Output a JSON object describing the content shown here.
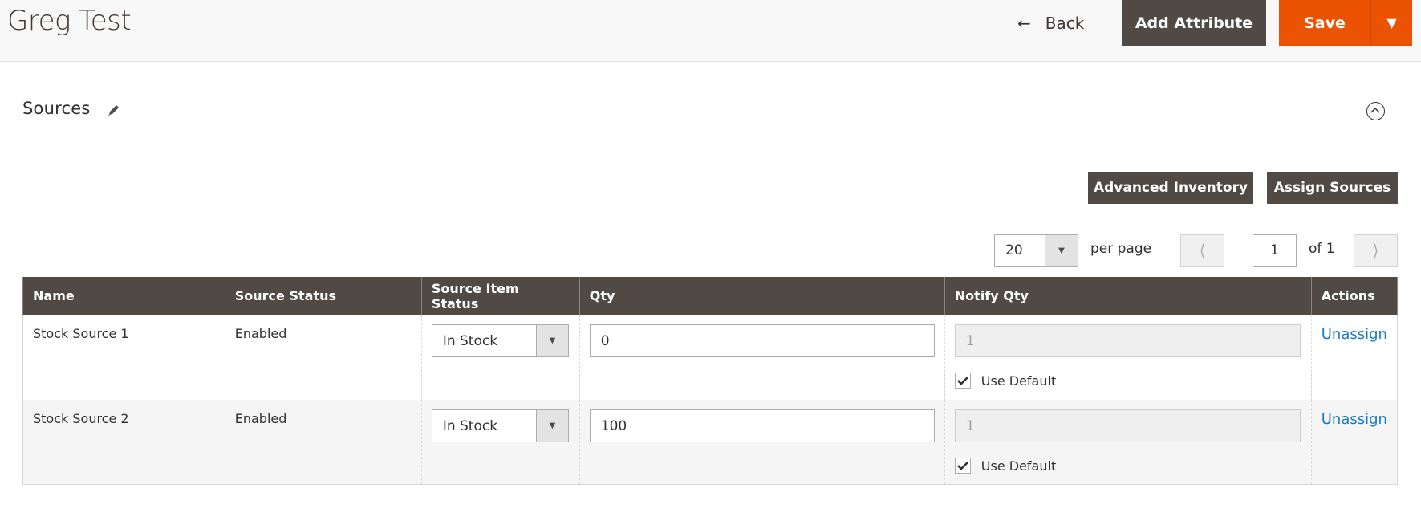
{
  "header": {
    "title": "Greg Test",
    "back_label": "Back",
    "add_attribute_label": "Add Attribute",
    "save_label": "Save"
  },
  "section": {
    "title": "Sources",
    "advanced_inventory_label": "Advanced Inventory",
    "assign_sources_label": "Assign Sources"
  },
  "pager": {
    "per_page_value": "20",
    "per_page_label": "per page",
    "current_page": "1",
    "of_label": "of 1"
  },
  "table": {
    "columns": [
      "Name",
      "Source Status",
      "Source Item Status",
      "Qty",
      "Notify Qty",
      "Actions"
    ],
    "rows": [
      {
        "name": "Stock Source 1",
        "source_status": "Enabled",
        "item_status": "In Stock",
        "qty": "0",
        "notify_qty": "1",
        "use_default_label": "Use Default",
        "use_default_checked": true,
        "action": "Unassign"
      },
      {
        "name": "Stock Source 2",
        "source_status": "Enabled",
        "item_status": "In Stock",
        "qty": "100",
        "notify_qty": "1",
        "use_default_label": "Use Default",
        "use_default_checked": true,
        "action": "Unassign"
      }
    ]
  },
  "colors": {
    "primary_orange": "#eb5202",
    "dark_button": "#514943",
    "link_blue": "#1979c3"
  }
}
